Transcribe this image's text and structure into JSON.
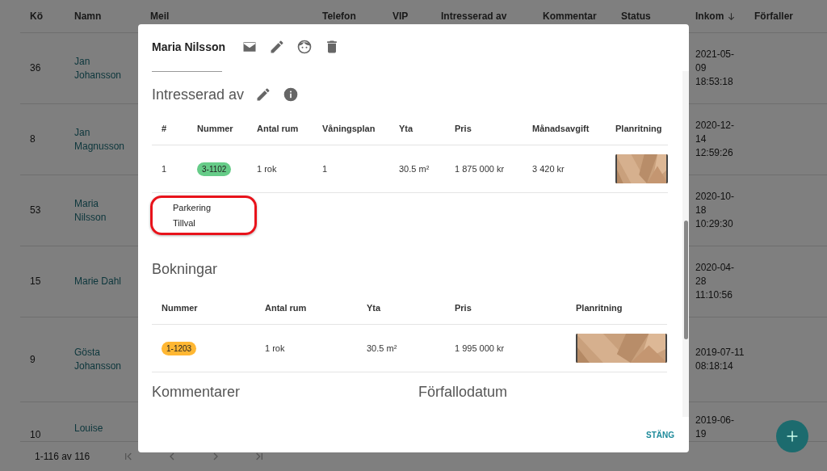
{
  "table": {
    "columns": [
      {
        "label": "Kö",
        "sorted": false
      },
      {
        "label": "Namn",
        "sorted": false
      },
      {
        "label": "Meil",
        "sorted": false
      },
      {
        "label": "Telefon",
        "sorted": false
      },
      {
        "label": "VIP",
        "sorted": false
      },
      {
        "label": "Intresserad av",
        "sorted": false
      },
      {
        "label": "Kommentar",
        "sorted": false
      },
      {
        "label": "Status",
        "sorted": false
      },
      {
        "label": "Inkom",
        "sorted": true
      },
      {
        "label": "Förfaller",
        "sorted": false
      }
    ],
    "rows": [
      {
        "queue": "36",
        "name": "Jan Johansson",
        "received": "2021-05-09 18:53:18"
      },
      {
        "queue": "8",
        "name": "Jan Magnusson",
        "received": "2020-12-14 12:59:26"
      },
      {
        "queue": "53",
        "name": "Maria Nilsson",
        "received": "2020-10-18 10:29:30"
      },
      {
        "queue": "15",
        "name": "Marie Dahl",
        "received": "2020-04-28 11:10:56"
      },
      {
        "queue": "9",
        "name": "Gösta Johansson",
        "received": "2019-07-11 08:18:14"
      },
      {
        "queue": "10",
        "name": "Louise",
        "received": "2019-06-19"
      }
    ]
  },
  "pagination": {
    "range": "1-116 av 116",
    "buttons": [
      {
        "kind": "first",
        "disabled": true
      },
      {
        "kind": "prev",
        "disabled": true
      },
      {
        "kind": "next",
        "disabled": true
      },
      {
        "kind": "last",
        "disabled": true
      }
    ]
  },
  "dialog": {
    "title": "Maria Nilsson",
    "interested": {
      "heading": "Intresserad av",
      "columns": [
        "#",
        "Nummer",
        "Antal rum",
        "Våningsplan",
        "Yta",
        "Pris",
        "Månadsavgift",
        "Planritning"
      ],
      "rows": [
        {
          "index": "1",
          "number": "3-1102",
          "color": "#66cc88",
          "rooms": "1 rok",
          "floor": "1",
          "area": "30.5 m²",
          "price": "1 875 000 kr",
          "fee": "3 420 kr"
        }
      ],
      "options": [
        "Parkering",
        "Tillval"
      ],
      "highlighted": true
    },
    "bookings": {
      "heading": "Bokningar",
      "columns": [
        "Nummer",
        "Antal rum",
        "Yta",
        "Pris",
        "Planritning"
      ],
      "rows": [
        {
          "number": "1-1203",
          "color": "#ffb733",
          "rooms": "1 rok",
          "area": "30.5 m²",
          "price": "1 995 000 kr"
        }
      ]
    },
    "sections": [
      "Kommentarer",
      "Förfallodatum"
    ],
    "close_button": "STÄNG"
  }
}
